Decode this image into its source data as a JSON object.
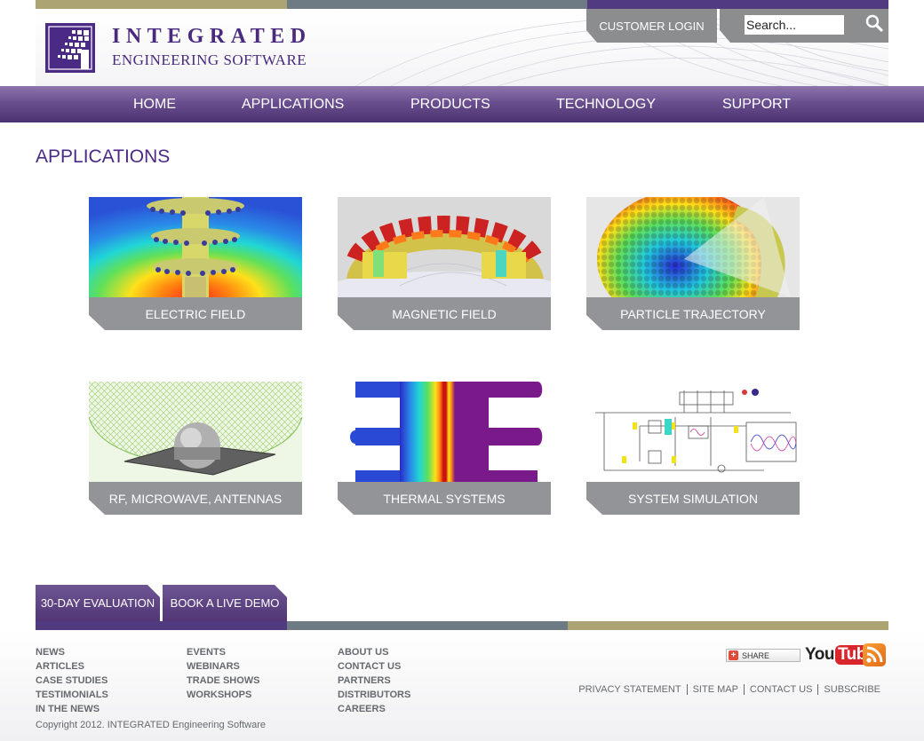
{
  "colors": {
    "purple": "#4b2a86",
    "olive": "#aca473",
    "slate": "#6f7b84",
    "gray_tab": "#929497"
  },
  "header": {
    "logo_line1": "INTEGRATED",
    "logo_line2": "ENGINEERING SOFTWARE",
    "login_label": "CUSTOMER LOGIN",
    "search_placeholder": "Search..."
  },
  "nav": {
    "items": [
      {
        "label": "HOME"
      },
      {
        "label": "APPLICATIONS"
      },
      {
        "label": "PRODUCTS"
      },
      {
        "label": "TECHNOLOGY"
      },
      {
        "label": "SUPPORT"
      }
    ]
  },
  "main": {
    "title": "APPLICATIONS",
    "tiles": [
      {
        "label": "ELECTRIC FIELD",
        "icon": "electric-field-simulation"
      },
      {
        "label": "MAGNETIC FIELD",
        "icon": "magnetic-field-simulation"
      },
      {
        "label": "PARTICLE TRAJECTORY",
        "icon": "particle-trajectory-simulation"
      },
      {
        "label": "RF, MICROWAVE, ANTENNAS",
        "icon": "antenna-radiation-pattern"
      },
      {
        "label": "THERMAL SYSTEMS",
        "icon": "thermal-gradient-heatsink"
      },
      {
        "label": "SYSTEM SIMULATION",
        "icon": "circuit-schematic"
      }
    ]
  },
  "footer": {
    "tabs": [
      {
        "label": "30-DAY EVALUATION"
      },
      {
        "label": "BOOK A LIVE DEMO"
      }
    ],
    "col1": [
      "NEWS",
      "ARTICLES",
      "CASE STUDIES",
      "TESTIMONIALS",
      "IN THE NEWS"
    ],
    "col2": [
      "EVENTS",
      "WEBINARS",
      "TRADE SHOWS",
      "WORKSHOPS"
    ],
    "col3": [
      "ABOUT US",
      "CONTACT US",
      "PARTNERS",
      "DISTRIBUTORS",
      "CAREERS"
    ],
    "legal": [
      "PRIVACY STATEMENT",
      "SITE MAP",
      "CONTACT US",
      "SUBSCRIBE"
    ],
    "share_label": "SHARE",
    "youtube_you": "You",
    "youtube_tube": "Tube",
    "copyright": "Copyright 2012. INTEGRATED Engineering Software"
  }
}
